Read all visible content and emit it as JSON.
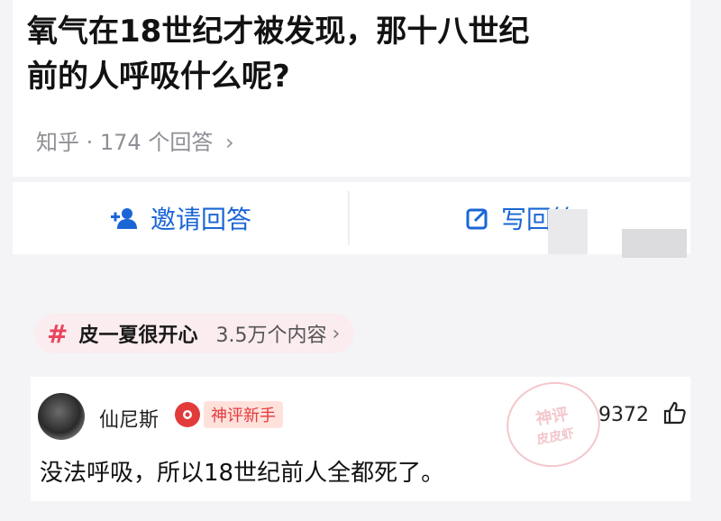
{
  "question": {
    "line1": "氧气在18世纪才被发现，那十八世纪",
    "line2": "前的人呼吸什么呢?"
  },
  "meta": {
    "source": "知乎",
    "dot": " · ",
    "answers": "174 个回答",
    "arrow": "›"
  },
  "actions": {
    "invite_label": "邀请回答",
    "write_label": "写回答",
    "invite_icon": "person-add-icon",
    "write_icon": "edit-icon",
    "accent_color": "#1a66d6"
  },
  "topic": {
    "hash": "#",
    "name": "皮一夏很开心",
    "count": "3.5万个内容",
    "arrow": "›"
  },
  "comment": {
    "username": "仙尼斯",
    "badge": "神评新手",
    "watermark_line1": "神评",
    "watermark_line2": "皮皮虾",
    "likes": "9372",
    "text": "没法呼吸，所以18世纪前人全都死了。"
  }
}
